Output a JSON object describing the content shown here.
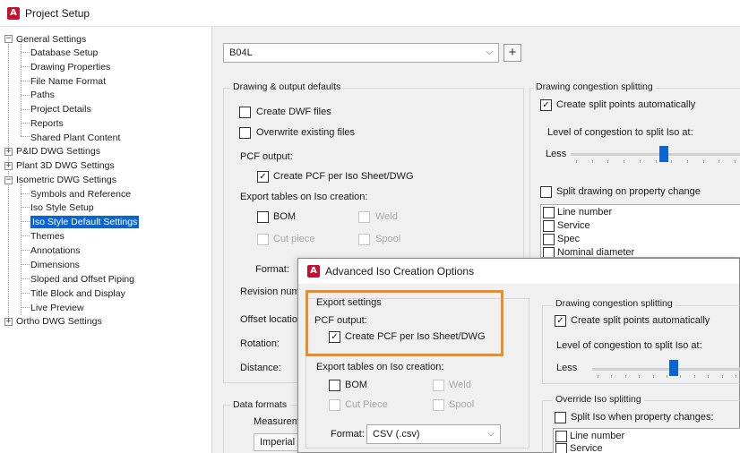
{
  "window": {
    "title": "Project Setup",
    "icon": "autocad-plant-icon"
  },
  "tree": {
    "items": [
      {
        "label": "General Settings",
        "expander": "−"
      },
      {
        "label": "Database Setup"
      },
      {
        "label": "Drawing Properties"
      },
      {
        "label": "File Name Format"
      },
      {
        "label": "Paths"
      },
      {
        "label": "Project Details"
      },
      {
        "label": "Reports"
      },
      {
        "label": "Shared Plant Content"
      },
      {
        "label": "P&ID DWG Settings",
        "expander": "+"
      },
      {
        "label": "Plant 3D DWG Settings",
        "expander": "+"
      },
      {
        "label": "Isometric DWG Settings",
        "expander": "−"
      },
      {
        "label": "Symbols and Reference"
      },
      {
        "label": "Iso Style Setup"
      },
      {
        "label": "Iso Style Default Settings",
        "selected": true
      },
      {
        "label": "Themes"
      },
      {
        "label": "Annotations"
      },
      {
        "label": "Dimensions"
      },
      {
        "label": "Sloped and Offset Piping"
      },
      {
        "label": "Title Block and Display"
      },
      {
        "label": "Live Preview"
      },
      {
        "label": "Ortho DWG Settings",
        "expander": "+"
      }
    ]
  },
  "style_select": {
    "value": "B04L",
    "caret": "⌵"
  },
  "plus_button": "+",
  "drawing_output": {
    "title": "Drawing & output defaults",
    "create_dwf": "Create DWF files",
    "overwrite": "Overwrite existing files",
    "pcf_output": "PCF output:",
    "create_pcf": "Create PCF per Iso Sheet/DWG",
    "check": "✓",
    "export_tables": "Export tables on Iso creation:",
    "bom": "BOM",
    "weld": "Weld",
    "cut_piece": "Cut piece",
    "spool": "Spool",
    "format": "Format:",
    "revision": "Revision num",
    "offset": "Offset locatio",
    "rotation": "Rotation:",
    "distance": "Distance:"
  },
  "data_formats": {
    "title": "Data formats",
    "measurement": "Measureme",
    "imperial": "Imperial"
  },
  "congestion": {
    "title": "Drawing congestion splitting",
    "auto_split": "Create split points automatically",
    "level": "Level of congestion to split Iso at:",
    "less": "Less",
    "level_value": 0.55,
    "split_on_change": "Split drawing on property change",
    "properties": [
      "Line number",
      "Service",
      "Spec",
      "Nominal diameter"
    ]
  },
  "dialog": {
    "title": "Advanced Iso Creation Options",
    "export_settings": "Export settings",
    "pcf_output": "PCF output:",
    "create_pcf": "Create PCF per Iso Sheet/DWG",
    "export_tables": "Export tables on Iso creation:",
    "bom": "BOM",
    "weld": "Weld",
    "cut_piece": "Cut Piece",
    "spool": "Spool",
    "format_label": "Format:",
    "format_value": "CSV (.csv)",
    "congestion_title": "Drawing congestion splitting",
    "auto_split": "Create split points automatically",
    "level": "Level of congestion to split Iso at:",
    "less": "Less",
    "level_value": 0.55,
    "override_title": "Override Iso splitting",
    "split_when": "Split Iso when property changes:",
    "properties": [
      "Line number",
      "Service"
    ]
  },
  "colors": {
    "accent": "#0a64d2",
    "highlight": "#f08a24",
    "brand": "#c8102e"
  }
}
